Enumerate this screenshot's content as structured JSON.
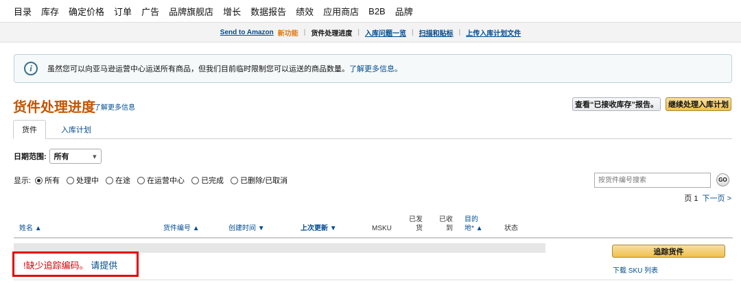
{
  "top_nav": [
    "目录",
    "库存",
    "确定价格",
    "订单",
    "广告",
    "品牌旗舰店",
    "增长",
    "数据报告",
    "绩效",
    "应用商店",
    "B2B",
    "品牌"
  ],
  "sub_nav": {
    "send_to_amazon": "Send to Amazon",
    "new_badge": "新功能",
    "shipment_progress": "货件处理进度",
    "inbound_issues": "入库问题一览",
    "scan_label": "扫描和贴标",
    "upload_plan": "上传入库计划文件",
    "separator": "|"
  },
  "info_banner": {
    "icon": "info-icon",
    "text": "虽然您可以向亚马逊运营中心运送所有商品，但我们目前临时限制您可以运送的商品数量。",
    "link": "了解更多信息。"
  },
  "page": {
    "title": "货件处理进度",
    "learn_more": "了解更多信息",
    "report_button": "查看“已接收库存”报告。",
    "continue_button": "继续处理入库计划"
  },
  "tabs": [
    "货件",
    "入库计划"
  ],
  "date_filter": {
    "label": "日期范围:",
    "selected": "所有",
    "chevron": "▾"
  },
  "status_filter": {
    "label": "显示:",
    "options": [
      "所有",
      "处理中",
      "在途",
      "在运营中心",
      "已完成",
      "已删除/已取消"
    ],
    "selected": "所有"
  },
  "search": {
    "placeholder": "按货件编号搜索",
    "go": "GO"
  },
  "pagination": {
    "page": "页 1",
    "next": "下一页 >"
  },
  "table_headers": {
    "name": "姓名 ▲",
    "shipment_id": "货件编号 ▲",
    "created": "创建时间 ▼",
    "updated": "上次更新 ▼",
    "msku": "MSKU",
    "shipped_1": "已发",
    "shipped_2": "货",
    "received_1": "已收",
    "received_2": "到",
    "dest_1": "目的",
    "dest_2": "地* ▲",
    "status": "状态"
  },
  "row": {
    "track_button": "追踪货件",
    "download_sku": "下载 SKU 列表",
    "error_prefix": "!缺少追踪编码。",
    "error_link": "请提供"
  },
  "colors": {
    "title_orange": "#c45500",
    "link_blue": "#004b91",
    "error_red": "#e30000"
  }
}
